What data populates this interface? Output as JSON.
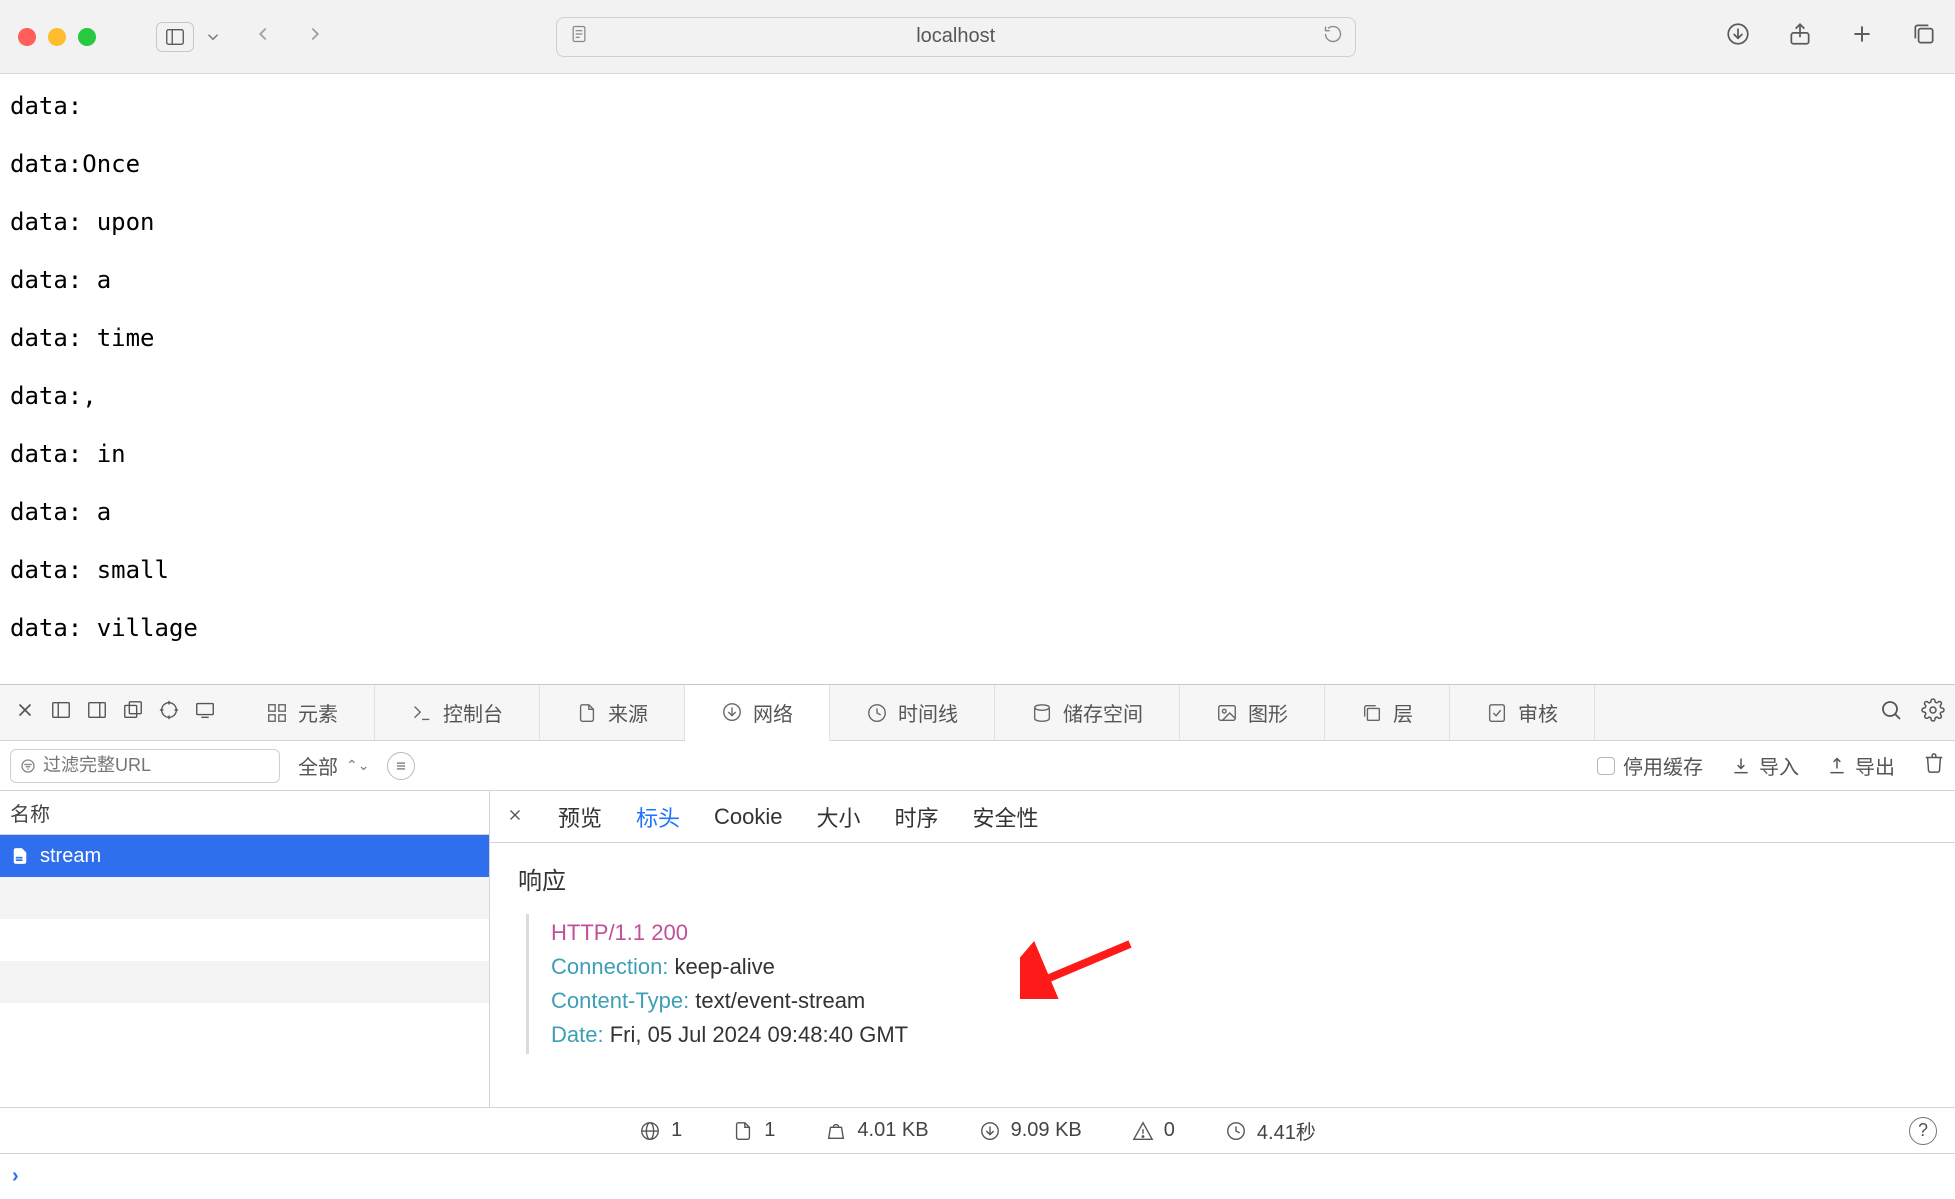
{
  "titlebar": {
    "url": "localhost"
  },
  "page_lines": [
    "data:",
    "data:Once",
    "data: upon",
    "data: a",
    "data: time",
    "data:,",
    "data: in",
    "data: a",
    "data: small",
    "data: village"
  ],
  "devtools": {
    "tabs": {
      "elements": "元素",
      "console": "控制台",
      "sources": "来源",
      "network": "网络",
      "timeline": "时间线",
      "storage": "储存空间",
      "graphics": "图形",
      "layers": "层",
      "audit": "审核"
    },
    "filterbar": {
      "placeholder": "过滤完整URL",
      "all": "全部",
      "disable_cache": "停用缓存",
      "import": "导入",
      "export": "导出"
    },
    "list": {
      "header": "名称",
      "rows": [
        "stream"
      ]
    },
    "detail": {
      "tabs": {
        "preview": "预览",
        "headers": "标头",
        "cookie": "Cookie",
        "size": "大小",
        "timing": "时序",
        "security": "安全性"
      },
      "section": "响应",
      "status_line": "HTTP/1.1 200",
      "headers": [
        {
          "k": "Connection:",
          "v": " keep-alive"
        },
        {
          "k": "Content-Type:",
          "v": " text/event-stream"
        },
        {
          "k": "Date:",
          "v": " Fri, 05 Jul 2024 09:48:40 GMT"
        }
      ]
    },
    "statusbar": {
      "requests": "1",
      "documents": "1",
      "weight": "4.01 KB",
      "transferred": "9.09 KB",
      "errors": "0",
      "time": "4.41秒"
    }
  }
}
